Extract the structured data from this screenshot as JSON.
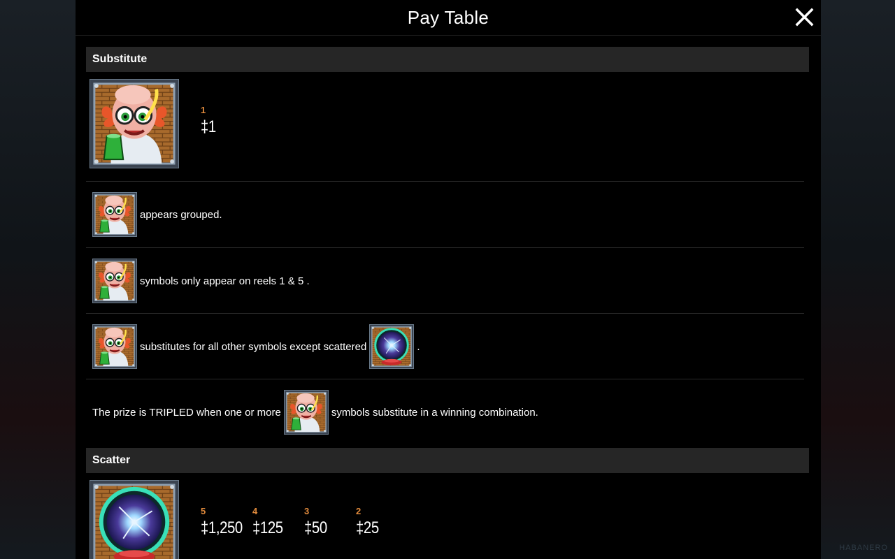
{
  "dialog": {
    "title": "Pay Table",
    "close_icon": "close-icon"
  },
  "watermark": "HABANERO",
  "substitute": {
    "header": "Substitute",
    "symbol_icon": "mad-scientist-wild-icon",
    "pays": [
      {
        "count": "1",
        "value": "‡1"
      }
    ],
    "rule_grouped": "appears grouped.",
    "rule_reels": "symbols only appear on reels 1 & 5 .",
    "rule_subs": "substitutes for all other symbols except scattered",
    "rule_subs_end": ".",
    "rule_prize_a": "The prize is TRIPLED when one or more",
    "rule_prize_b": "symbols substitute in a winning combination."
  },
  "scatter": {
    "header": "Scatter",
    "symbol_icon": "plasma-ball-scatter-icon",
    "pays": [
      {
        "count": "5",
        "value": "‡1,250"
      },
      {
        "count": "4",
        "value": "‡125"
      },
      {
        "count": "3",
        "value": "‡50"
      },
      {
        "count": "2",
        "value": "‡25"
      }
    ]
  },
  "colors": {
    "count": "#e08a3c",
    "section_header": "#262626",
    "panel": "#000000"
  }
}
